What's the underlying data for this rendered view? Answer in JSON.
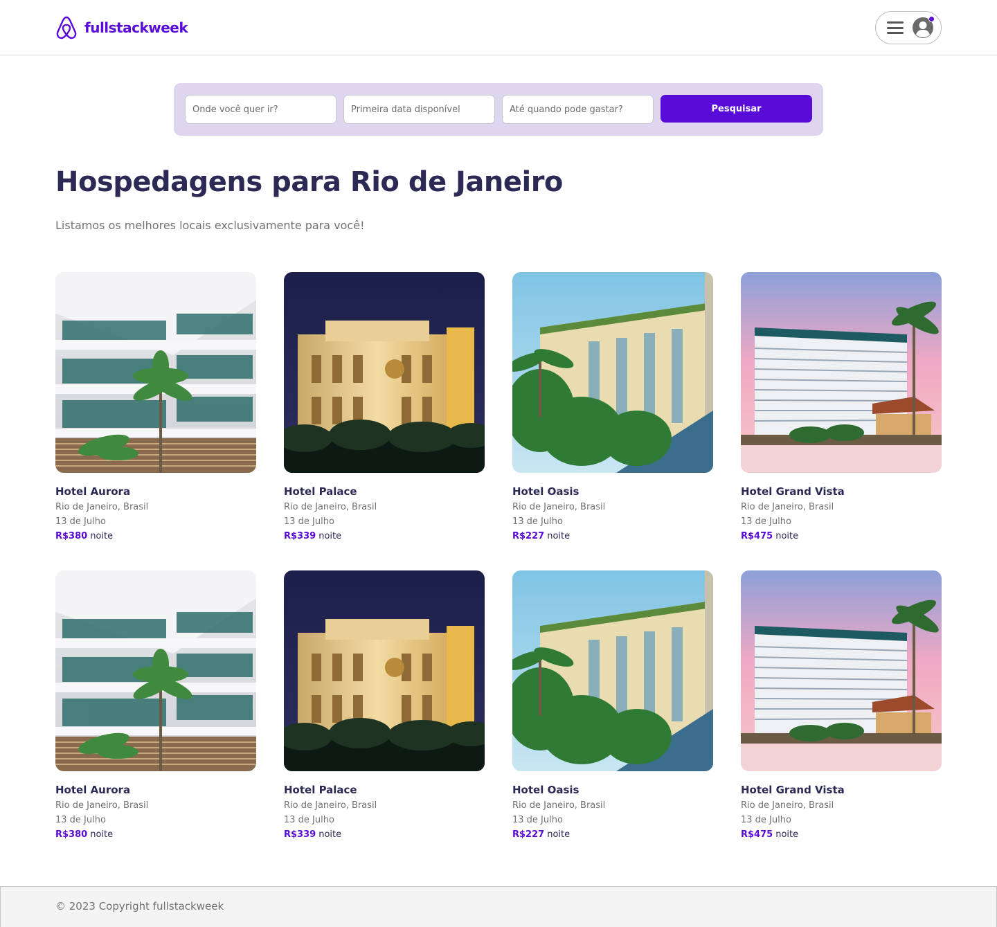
{
  "brand": {
    "name": "fullstackweek",
    "icon": "airbnb-logo-icon",
    "color": "#590bd8"
  },
  "header": {
    "menu_icon": "hamburger-icon",
    "avatar_icon": "user-avatar-icon"
  },
  "search": {
    "destination_placeholder": "Onde você quer ir?",
    "date_placeholder": "Primeira data disponível",
    "budget_placeholder": "Até quando pode gastar?",
    "button_label": "Pesquisar"
  },
  "main": {
    "title": "Hospedagens para Rio de Janeiro",
    "subtitle": "Listamos os melhores locais exclusivamente para você!"
  },
  "trips": [
    {
      "name": "Hotel Aurora",
      "location": "Rio de Janeiro, Brasil",
      "date": "13 de Julho",
      "price": "R$380",
      "unit": "noite",
      "image": "hotel-aurora-photo"
    },
    {
      "name": "Hotel Palace",
      "location": "Rio de Janeiro, Brasil",
      "date": "13 de Julho",
      "price": "R$339",
      "unit": "noite",
      "image": "hotel-palace-photo"
    },
    {
      "name": "Hotel Oasis",
      "location": "Rio de Janeiro, Brasil",
      "date": "13 de Julho",
      "price": "R$227",
      "unit": "noite",
      "image": "hotel-oasis-photo"
    },
    {
      "name": "Hotel Grand Vista",
      "location": "Rio de Janeiro, Brasil",
      "date": "13 de Julho",
      "price": "R$475",
      "unit": "noite",
      "image": "hotel-grand-vista-photo"
    },
    {
      "name": "Hotel Aurora",
      "location": "Rio de Janeiro, Brasil",
      "date": "13 de Julho",
      "price": "R$380",
      "unit": "noite",
      "image": "hotel-aurora-photo"
    },
    {
      "name": "Hotel Palace",
      "location": "Rio de Janeiro, Brasil",
      "date": "13 de Julho",
      "price": "R$339",
      "unit": "noite",
      "image": "hotel-palace-photo"
    },
    {
      "name": "Hotel Oasis",
      "location": "Rio de Janeiro, Brasil",
      "date": "13 de Julho",
      "price": "R$227",
      "unit": "noite",
      "image": "hotel-oasis-photo"
    },
    {
      "name": "Hotel Grand Vista",
      "location": "Rio de Janeiro, Brasil",
      "date": "13 de Julho",
      "price": "R$475",
      "unit": "noite",
      "image": "hotel-grand-vista-photo"
    }
  ],
  "footer": {
    "copyright": "© 2023 Copyright fullstackweek"
  }
}
